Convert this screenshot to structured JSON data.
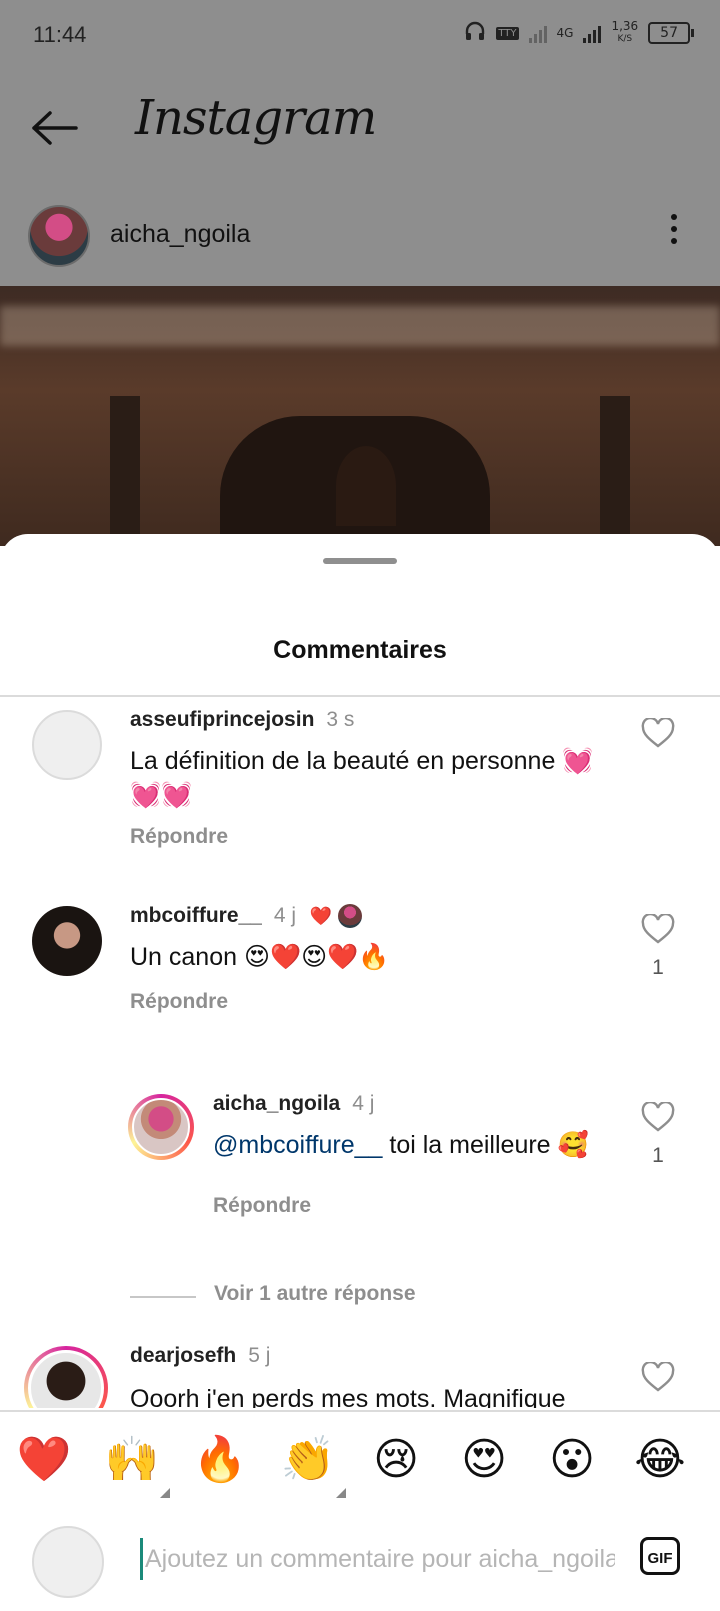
{
  "status_bar": {
    "time": "11:44",
    "network_type": "4G",
    "tty_label": "TTY",
    "speed_value": "1,36",
    "speed_unit": "K/S",
    "battery": "57"
  },
  "app_bar": {
    "title": "Instagram"
  },
  "post": {
    "username": "aicha_ngoila"
  },
  "sheet": {
    "title": "Commentaires"
  },
  "comments": [
    {
      "username": "asseufiprincejosin",
      "time": "3 s",
      "text": "La définition de la beauté en personne 💓💓💓",
      "reply_label": "Répondre",
      "likes": ""
    },
    {
      "username": "mbcoiffure__",
      "time": "4 j",
      "creator_liked": "❤️",
      "text": "Un canon 😍❤️😍❤️🔥",
      "reply_label": "Répondre",
      "likes": "1"
    },
    {
      "username": "aicha_ngoila",
      "time": "4 j",
      "mention": "@mbcoiffure__",
      "text": " toi la meilleure 🥰",
      "reply_label": "Répondre",
      "likes": "1"
    },
    {
      "username": "dearjosefh",
      "time": "5 j",
      "text": "Ooorh j'en perds mes mots. Magnifique"
    }
  ],
  "view_more_replies": "Voir 1 autre réponse",
  "emoji_bar": [
    "❤️",
    "🙌",
    "🔥",
    "👏",
    "😢",
    "😍",
    "😮",
    "😂"
  ],
  "composer": {
    "placeholder": "Ajoutez un commentaire pour aicha_ngoila...",
    "gif_label": "GIF"
  },
  "colors": {
    "dim_overlay": "#8e8e8e",
    "mention": "#00376b",
    "secondary_text": "#8e8e8e"
  }
}
